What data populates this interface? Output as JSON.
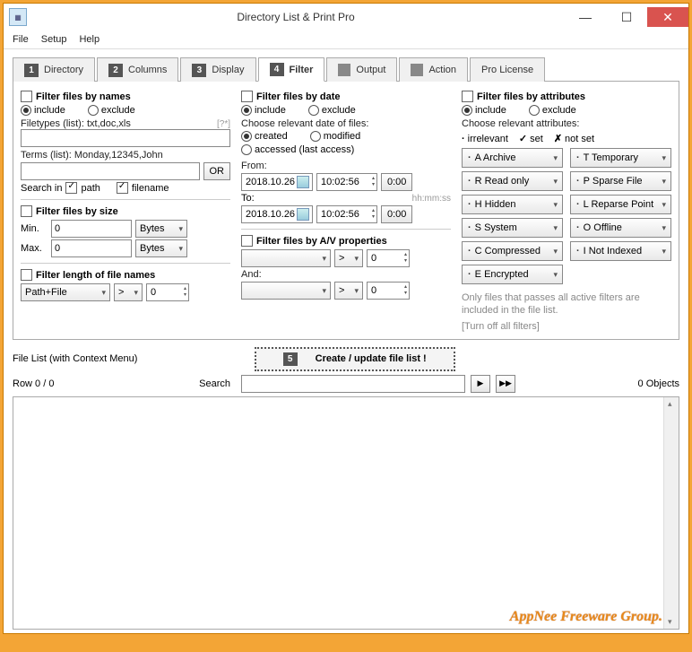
{
  "title": "Directory List & Print Pro",
  "menu": [
    "File",
    "Setup",
    "Help"
  ],
  "tabs": [
    {
      "num": "1",
      "label": "Directory"
    },
    {
      "num": "2",
      "label": "Columns"
    },
    {
      "num": "3",
      "label": "Display"
    },
    {
      "num": "4",
      "label": "Filter"
    },
    {
      "ico": true,
      "label": "Output"
    },
    {
      "ico": true,
      "label": "Action"
    },
    {
      "label": "Pro License"
    }
  ],
  "col1": {
    "names_title": "Filter files by names",
    "include": "include",
    "exclude": "exclude",
    "filetypes_lbl": "Filetypes (list): txt,doc,xls",
    "filetypes_hint": "[?*]",
    "terms_lbl": "Terms (list): Monday,12345,John",
    "or": "OR",
    "searchin": "Search in",
    "path": "path",
    "filename": "filename",
    "size_title": "Filter files by size",
    "min": "Min.",
    "max": "Max.",
    "min_v": "0",
    "max_v": "0",
    "unit": "Bytes",
    "len_title": "Filter length of file names",
    "pathfile": "Path+File",
    "op": ">",
    "len_v": "0"
  },
  "col2": {
    "date_title": "Filter files by date",
    "include": "include",
    "exclude": "exclude",
    "choose": "Choose relevant date of files:",
    "created": "created",
    "modified": "modified",
    "accessed": "accessed (last access)",
    "from": "From:",
    "to": "To:",
    "hhmmss": "hh:mm:ss",
    "d1": "2018.10.26",
    "t1": "10:02:56",
    "z": "0:00",
    "d2": "2018.10.26",
    "t2": "10:02:56",
    "av_title": "Filter files by A/V properties",
    "op": ">",
    "v1": "0",
    "and": "And:",
    "v2": "0"
  },
  "col3": {
    "attr_title": "Filter files by attributes",
    "include": "include",
    "exclude": "exclude",
    "choose": "Choose relevant attributes:",
    "leg_irr": "irrelevant",
    "leg_set": "set",
    "leg_not": "not set",
    "attrs": [
      "A Archive",
      "T Temporary",
      "R Read only",
      "P Sparse File",
      "H Hidden",
      "L Reparse Point",
      "S System",
      "O Offline",
      "C Compressed",
      "I  Not Indexed",
      "E Encrypted"
    ],
    "note1": "Only files that passes all active filters are included in the file list.",
    "turnoff": "[Turn off all filters]"
  },
  "filelist_lbl": "File List (with Context Menu)",
  "create_num": "5",
  "create_lbl": "Create / update file list !",
  "row_lbl": "Row 0 / 0",
  "search_lbl": "Search",
  "objects": "0 Objects",
  "watermark": "AppNee Freeware Group."
}
